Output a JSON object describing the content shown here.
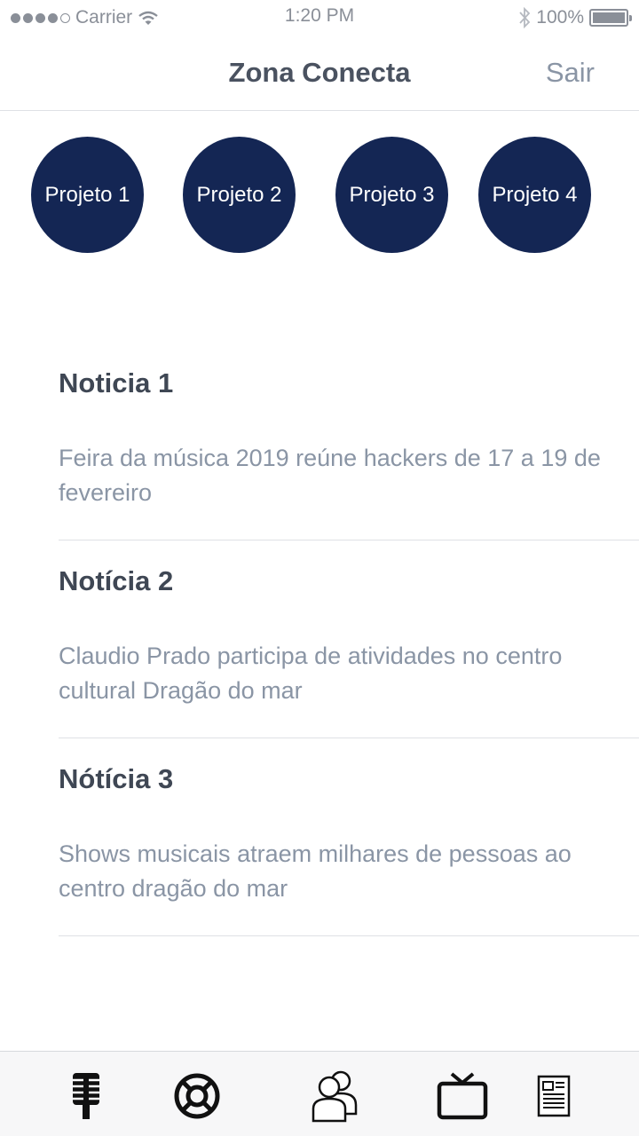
{
  "status_bar": {
    "carrier": "Carrier",
    "time": "1:20 PM",
    "battery": "100%",
    "battery_level": 1.0
  },
  "nav": {
    "title": "Zona Conecta",
    "action": "Sair"
  },
  "projects": [
    {
      "label": "Projeto 1"
    },
    {
      "label": "Projeto 2"
    },
    {
      "label": "Projeto 3"
    },
    {
      "label": "Projeto 4"
    }
  ],
  "news": [
    {
      "title": "Noticia 1",
      "body": "Feira da música 2019 reúne hackers de 17 a 19 de fevereiro"
    },
    {
      "title": "Notícia 2",
      "body": "Claudio Prado participa de atividades no centro cultural Dragão do mar"
    },
    {
      "title": "Nótícia 3",
      "body": "Shows musicais atraem milhares de pessoas ao centro dragão do mar"
    }
  ],
  "tabs": [
    {
      "icon": "microphone-icon"
    },
    {
      "icon": "lifebuoy-icon"
    },
    {
      "icon": "users-icon"
    },
    {
      "icon": "tv-icon"
    },
    {
      "icon": "newspaper-icon"
    }
  ],
  "colors": {
    "accent": "#142654",
    "muted_text": "#8a95a5",
    "title_text": "#3f4754"
  }
}
